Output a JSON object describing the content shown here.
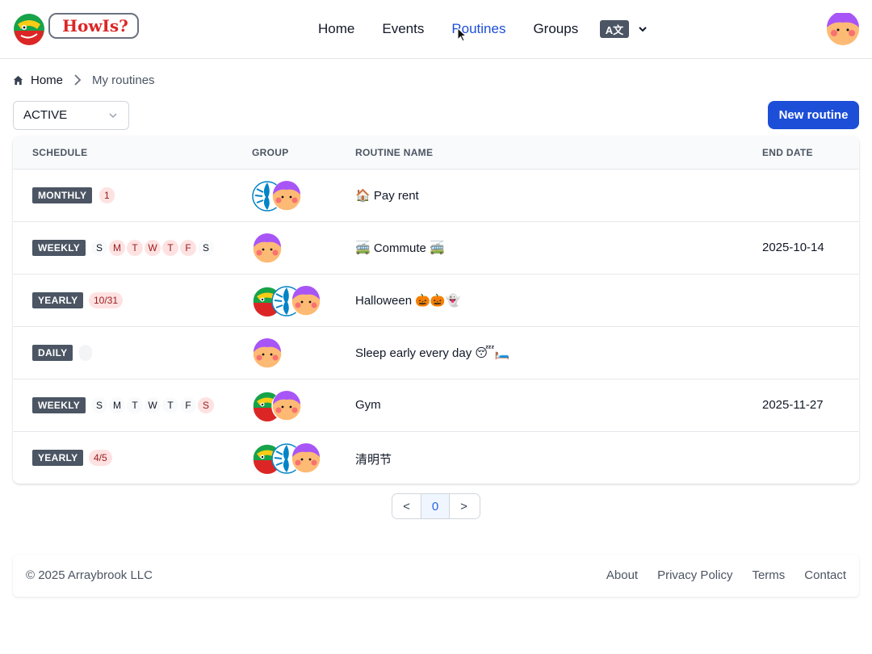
{
  "header": {
    "logo_text": "HowIs?",
    "nav": [
      "Home",
      "Events",
      "Routines",
      "Groups"
    ],
    "active_nav": "Routines",
    "lang_icon_text": "A文"
  },
  "breadcrumb": {
    "home": "Home",
    "current": "My routines"
  },
  "toolbar": {
    "status_value": "ACTIVE",
    "new_button": "New routine"
  },
  "table": {
    "headers": {
      "schedule": "SCHEDULE",
      "group": "GROUP",
      "name": "ROUTINE NAME",
      "end_date": "END DATE"
    },
    "rows": [
      {
        "schedule": "MONTHLY",
        "pill": "1",
        "name": "🏠 Pay rent",
        "end_date": "",
        "group": [
          "zebra",
          "girl"
        ]
      },
      {
        "schedule": "WEEKLY",
        "days": [
          "S",
          "M",
          "T",
          "W",
          "T",
          "F",
          "S"
        ],
        "days_on": [
          false,
          true,
          true,
          true,
          true,
          true,
          false
        ],
        "name": "🚎 Commute 🚎",
        "end_date": "2025-10-14",
        "group": [
          "girl"
        ]
      },
      {
        "schedule": "YEARLY",
        "pill": "10/31",
        "name": "Halloween 🎃🎃👻",
        "end_date": "",
        "group": [
          "lizard",
          "zebra",
          "girl"
        ]
      },
      {
        "schedule": "DAILY",
        "pill": "",
        "name": "Sleep early every day 😴🛏️",
        "end_date": "",
        "group": [
          "girl"
        ]
      },
      {
        "schedule": "WEEKLY",
        "days": [
          "S",
          "M",
          "T",
          "W",
          "T",
          "F",
          "S"
        ],
        "days_on": [
          false,
          false,
          false,
          false,
          false,
          false,
          true
        ],
        "name": "Gym",
        "end_date": "2025-11-27",
        "group": [
          "lizard",
          "girl"
        ]
      },
      {
        "schedule": "YEARLY",
        "pill": "4/5",
        "name": "清明节",
        "end_date": "",
        "group": [
          "lizard",
          "zebra",
          "girl"
        ]
      }
    ]
  },
  "pagination": {
    "prev": "<",
    "current": "0",
    "next": ">"
  },
  "footer": {
    "copyright": "© 2025 Arraybrook LLC",
    "links": [
      "About",
      "Privacy Policy",
      "Terms",
      "Contact"
    ]
  },
  "colors": {
    "accent": "#1d4ed8",
    "badge": "#4b5563",
    "pill_bg": "#fee2e2",
    "pill_text": "#991b1b"
  }
}
